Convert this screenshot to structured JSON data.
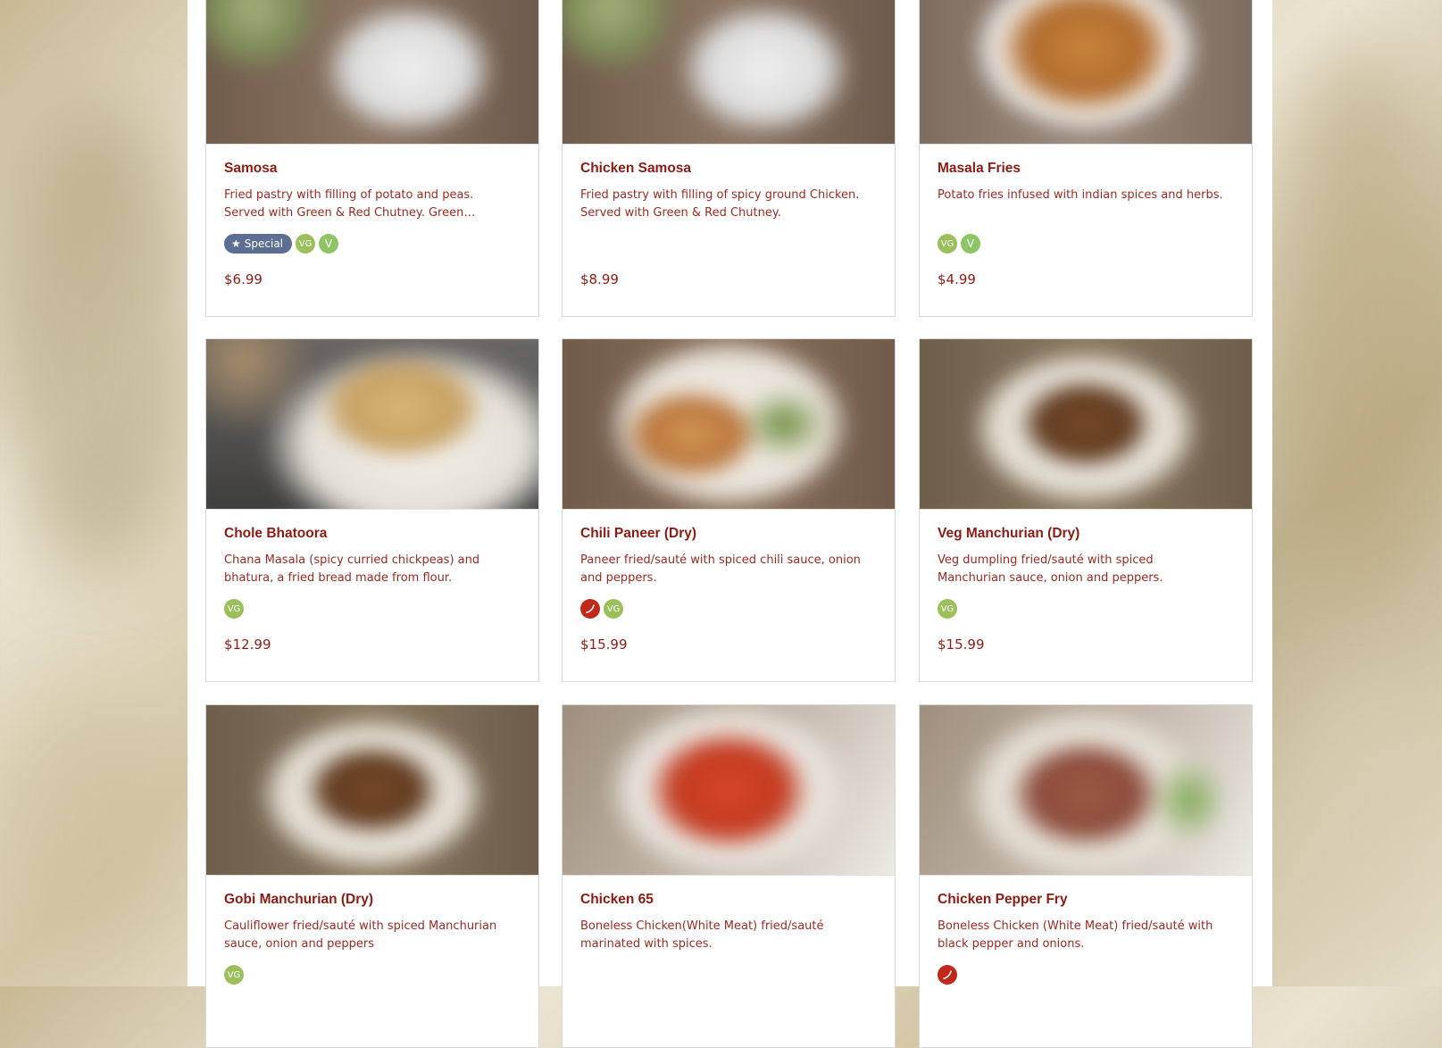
{
  "menu": {
    "items": [
      {
        "name": "Samosa",
        "desc": "Fried pastry with filling of potato and peas. Served with Green & Red Chutney. Green Chutney",
        "price": "$6.99",
        "special_label": "Special"
      },
      {
        "name": "Chicken Samosa",
        "desc": "Fried pastry with filling of spicy ground Chicken. Served with Green & Red Chutney.",
        "price": "$8.99"
      },
      {
        "name": "Masala Fries",
        "desc": "Potato fries infused with indian spices and herbs.",
        "price": "$4.99"
      },
      {
        "name": "Chole Bhatoora",
        "desc": "Chana Masala (spicy curried chickpeas) and bhatura, a fried bread made from flour.",
        "price": "$12.99"
      },
      {
        "name": "Chili Paneer (Dry)",
        "desc": "Paneer fried/sauté with spiced chili sauce, onion and peppers.",
        "price": "$15.99"
      },
      {
        "name": "Veg Manchurian (Dry)",
        "desc": "Veg dumpling fried/sauté with spiced Manchurian sauce, onion and peppers.",
        "price": "$15.99"
      },
      {
        "name": "Gobi Manchurian (Dry)",
        "desc": "Cauliflower fried/sauté with spiced Manchurian sauce, onion and peppers",
        "price": ""
      },
      {
        "name": "Chicken 65",
        "desc": "Boneless Chicken(White Meat) fried/sauté marinated with spices.",
        "price": ""
      },
      {
        "name": "Chicken Pepper Fry",
        "desc": "Boneless Chicken (White Meat) fried/sauté with black pepper and onions.",
        "price": ""
      }
    ],
    "badges": {
      "vegan": "VG",
      "vegetarian": "V"
    }
  },
  "colors": {
    "title": "#8c1c13",
    "vegan_badge": "#9bbf5a",
    "veg_badge": "#8cc466",
    "spicy_badge": "#c0291a",
    "special_badge": "#5c6f93"
  }
}
